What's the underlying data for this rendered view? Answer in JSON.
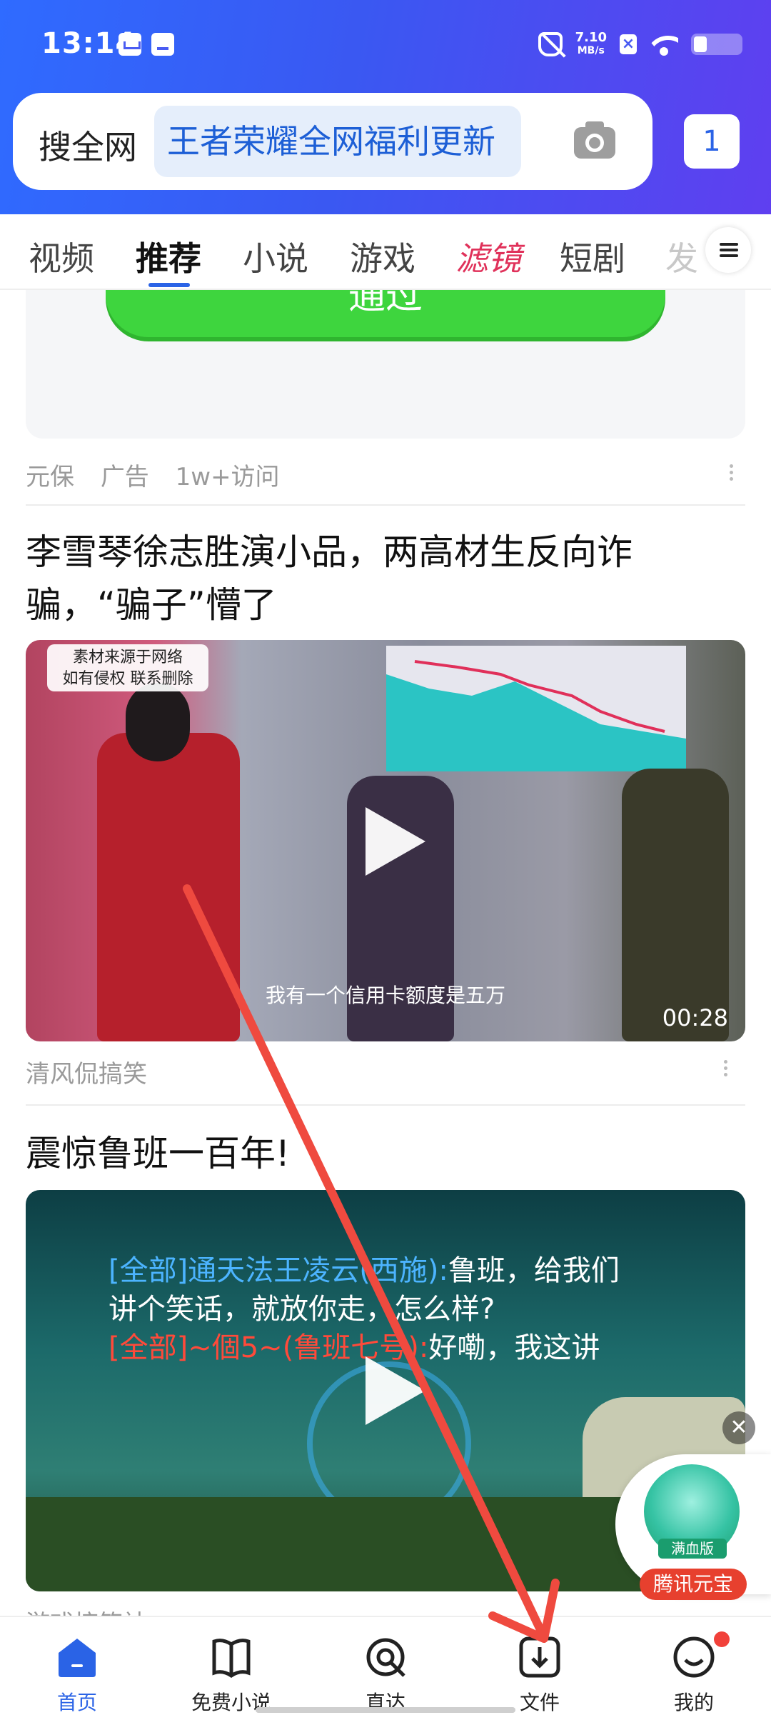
{
  "status_bar": {
    "time": "13:14",
    "net_speed_value": "7.10",
    "net_speed_unit": "MB/s"
  },
  "search": {
    "label": "搜全网",
    "hot_query": "王者荣耀全网福利更新",
    "tab_count": "1"
  },
  "categories": [
    "视频",
    "推荐",
    "小说",
    "游戏",
    "滤镜",
    "短剧",
    "发"
  ],
  "active_category": "推荐",
  "feed": {
    "ad": {
      "button_label": "通过",
      "meta": [
        "元保",
        "广告",
        "1w+访问"
      ]
    },
    "items": [
      {
        "title": "李雪琴徐志胜演小品，两高材生反向诈骗，“骗子”懵了",
        "watermark_line1": "素材来源于网络",
        "watermark_line2": "如有侵权  联系删除",
        "subtitle": "我有一个信用卡额度是五万",
        "duration": "00:28",
        "author": "清风侃搞笑"
      },
      {
        "title": "震惊鲁班一百年!",
        "game_line1_tag": "[全部]通天法王凌云(西施):",
        "game_line1_text": "鲁班，给我们",
        "game_line2": "讲个笑话，就放你走，怎么样?",
        "game_line3_tag": "[全部]~個5~(鲁班七号):",
        "game_line3_text": "好嘞，我这讲",
        "author_peek": "游戏搞笑社"
      }
    ]
  },
  "floating_ad": {
    "logo_label": "满血版",
    "tag": "腾讯元宝",
    "close": "✕"
  },
  "bottom_nav": [
    {
      "label": "首页",
      "icon": "home-icon"
    },
    {
      "label": "免费小说",
      "icon": "book-icon"
    },
    {
      "label": "直达",
      "icon": "direct-icon"
    },
    {
      "label": "文件",
      "icon": "download-file-icon"
    },
    {
      "label": "我的",
      "icon": "profile-smile-icon"
    }
  ],
  "colors": {
    "accent": "#2a63e6",
    "annotation_arrow": "#ef4a3f",
    "filter_tab": "#e0315a",
    "ad_button": "#3ed53e"
  }
}
